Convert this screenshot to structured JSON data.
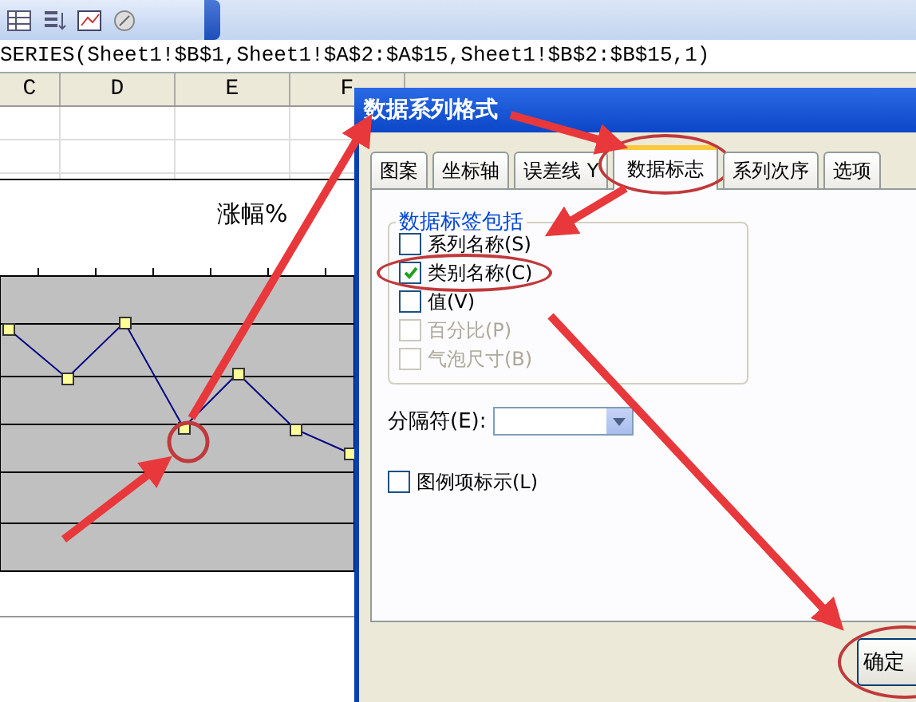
{
  "formula_bar": {
    "formula": "SERIES(Sheet1!$B$1,Sheet1!$A$2:$A$15,Sheet1!$B$2:$B$15,1)"
  },
  "columns": [
    "C",
    "D",
    "E",
    "F"
  ],
  "chart": {
    "title": "涨幅%"
  },
  "dialog": {
    "title": "数据系列格式",
    "tabs": [
      {
        "label": "图案",
        "selected": false
      },
      {
        "label": "坐标轴",
        "selected": false
      },
      {
        "label": "误差线 Y",
        "selected": false
      },
      {
        "label": "数据标志",
        "selected": true
      },
      {
        "label": "系列次序",
        "selected": false
      },
      {
        "label": "选项",
        "selected": false
      }
    ],
    "group_label": "数据标签包括",
    "options": [
      {
        "label": "系列名称(S)",
        "checked": false,
        "disabled": false
      },
      {
        "label": "类别名称(C)",
        "checked": true,
        "disabled": false
      },
      {
        "label": "值(V)",
        "checked": false,
        "disabled": false
      },
      {
        "label": "百分比(P)",
        "checked": false,
        "disabled": true
      },
      {
        "label": "气泡尺寸(B)",
        "checked": false,
        "disabled": true
      }
    ],
    "separator_label": "分隔符(E):",
    "legend_key": {
      "label": "图例项标示(L)",
      "checked": false
    },
    "buttons": [
      "确定"
    ]
  }
}
